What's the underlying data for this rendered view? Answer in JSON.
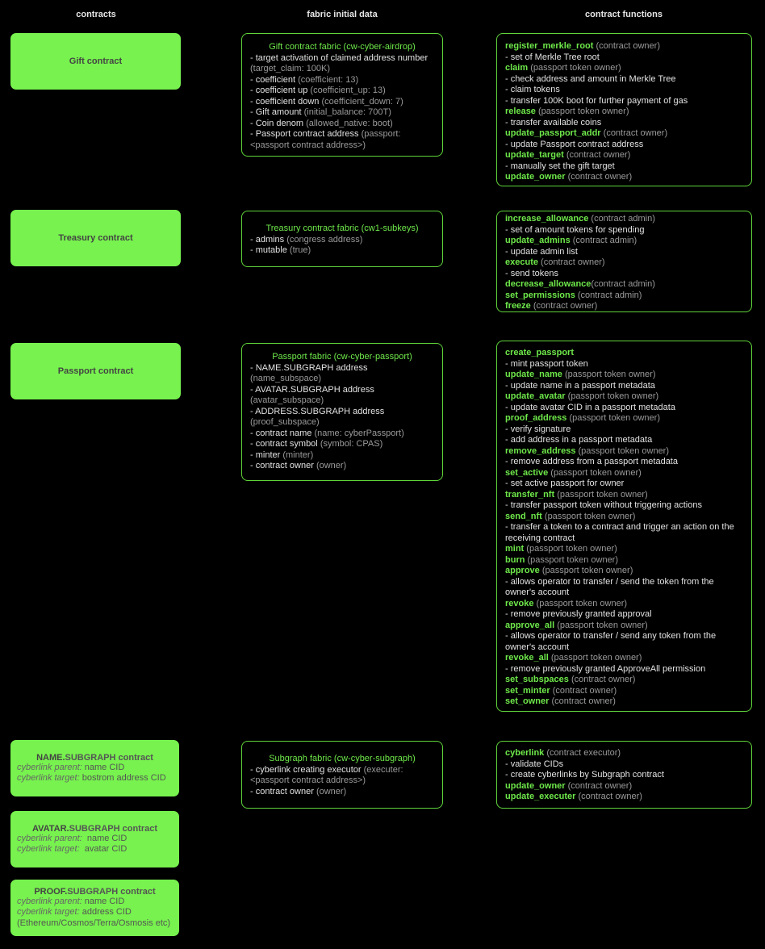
{
  "headers": {
    "contracts": "contracts",
    "fabric": "fabric initial data",
    "functions": "contract functions"
  },
  "rows": {
    "gift": {
      "contract": "Gift contract",
      "fabric_title": "Gift contract fabric (cw-cyber-airdrop)",
      "fabric_lines": [
        {
          "label": "- target activation of claimed address number",
          "value": ""
        },
        {
          "label": "",
          "value": "(target_claim: 100K)"
        },
        {
          "label": "- coefficient",
          "value": "(coefficient: 13)"
        },
        {
          "label": "- coefficient up",
          "value": "(coefficient_up: 13)"
        },
        {
          "label": "- coefficient down",
          "value": "(coefficient_down: 7)"
        },
        {
          "label": "- Gift amount",
          "value": "(initial_balance: 700T)"
        },
        {
          "label": "- Coin denom",
          "value": "(allowed_native: boot)"
        },
        {
          "label": "- Passport contract address",
          "value": "(passport:"
        },
        {
          "label": "",
          "value": "<passport contract address>)"
        }
      ],
      "functions": [
        {
          "name": "register_merkle_root",
          "role": "(contract owner)"
        },
        {
          "desc": "- set of Merkle Tree root"
        },
        {
          "name": "claim",
          "role": "(passport token owner)"
        },
        {
          "desc": "- check address and amount in Merkle Tree"
        },
        {
          "desc": "- claim tokens"
        },
        {
          "desc": "- transfer 100K boot for further payment of gas"
        },
        {
          "name": "release",
          "role": "(passport token owner)"
        },
        {
          "desc": "- transfer available coins"
        },
        {
          "name": "update_passport_addr",
          "role": "(contract owner)"
        },
        {
          "desc": "- update Passport contract address"
        },
        {
          "name": "update_target",
          "role": "(contract owner)"
        },
        {
          "desc": "- manually set the gift target"
        },
        {
          "name": "update_owner",
          "role": "(contract owner)"
        }
      ]
    },
    "treasury": {
      "contract": "Treasury contract",
      "fabric_title": "Treasury contract fabric (cw1-subkeys)",
      "fabric_lines": [
        {
          "label": "- admins ",
          "value": "(congress address)"
        },
        {
          "label": "- mutable",
          "value": "(true)"
        }
      ],
      "functions": [
        {
          "name": "increase_allowance",
          "role": "(contract admin)"
        },
        {
          "desc": "- set of amount tokens for spending"
        },
        {
          "name": "update_admins",
          "role": "(contract admin)"
        },
        {
          "desc": "- update admin list"
        },
        {
          "name": "execute",
          "role": "(contract owner)"
        },
        {
          "desc": "- send tokens"
        },
        {
          "name": "decrease_allowance",
          "role": "(contract admin)",
          "nospace": true
        },
        {
          "name": "set_permissions",
          "role": "(contract admin)"
        },
        {
          "name": "freeze",
          "role": "(contract owner)"
        }
      ]
    },
    "passport": {
      "contract": "Passport contract",
      "fabric_title": "Passport fabric (cw-cyber-passport)",
      "fabric_lines": [
        {
          "label": "- NAME.SUBGRAPH address",
          "value": ""
        },
        {
          "label": "",
          "value": "(name_subspace)"
        },
        {
          "label": "- AVATAR.SUBGRAPH address",
          "value": ""
        },
        {
          "label": "",
          "value": "(avatar_subspace)"
        },
        {
          "label": "- ADDRESS.SUBGRAPH address",
          "value": ""
        },
        {
          "label": "",
          "value": "(proof_subspace)"
        },
        {
          "label": "- contract name",
          "value": "(name: cyberPassport)"
        },
        {
          "label": "- contract symbol",
          "value": "(symbol: CPAS)"
        },
        {
          "label": "- minter",
          "value": "(minter)"
        },
        {
          "label": "- contract owner",
          "value": "(owner)"
        }
      ],
      "functions": [
        {
          "name": "create_passport",
          "role": ""
        },
        {
          "desc": "- mint passport token"
        },
        {
          "name": "update_name",
          "role": "(passport token owner)"
        },
        {
          "desc": "- update name in a passport metadata"
        },
        {
          "name": "update_avatar",
          "role": "(passport token owner)"
        },
        {
          "desc": "- update avatar CID in a passport metadata"
        },
        {
          "name": "proof_address",
          "role": "(passport token owner)"
        },
        {
          "desc": "- verify signature"
        },
        {
          "desc": "- add address in a passport metadata"
        },
        {
          "name": "remove_address",
          "role": "(passport token owner)"
        },
        {
          "desc": "- remove address from a passport metadata"
        },
        {
          "name": "set_active",
          "role": "(passport token owner)"
        },
        {
          "desc": "- set active passport for owner"
        },
        {
          "name": "transfer_nft",
          "role": "(passport token owner)"
        },
        {
          "desc": "- transfer passport token without triggering actions"
        },
        {
          "name": "send_nft",
          "role": "(passport token owner)"
        },
        {
          "desc": "- transfer a token to a contract and trigger an action on the"
        },
        {
          "desc": "receiving contract"
        },
        {
          "name": "mint",
          "role": "(passport token owner)"
        },
        {
          "name": "burn",
          "role": "(passport token owner)"
        },
        {
          "name": "approve",
          "role": "(passport token owner)"
        },
        {
          "desc": "- allows operator to transfer / send the token from the"
        },
        {
          "desc": "owner's account"
        },
        {
          "name": "revoke",
          "role": "(passport token owner)"
        },
        {
          "desc": "- remove previously granted approval"
        },
        {
          "name": "approve_all",
          "role": "(passport token owner)"
        },
        {
          "desc": "- allows operator to transfer / send any token from the"
        },
        {
          "desc": "owner's account"
        },
        {
          "name": "revoke_all",
          "role": "(passport token owner)"
        },
        {
          "desc": "- remove previously granted ApproveAll permission"
        },
        {
          "name": "set_subspaces",
          "role": "(contract owner)"
        },
        {
          "name": "set_minter",
          "role": "(contract owner)"
        },
        {
          "name": "set_owner",
          "role": "(contract owner)"
        }
      ]
    },
    "subgraph": {
      "contracts": [
        {
          "title_prefix": "NAME.",
          "title_rest": "SUBGRAPH contract",
          "lines": [
            {
              "label": "cyberlink parent:",
              "value": " name CID"
            },
            {
              "label": "cyberlink target:",
              "value": " bostrom address CID"
            }
          ]
        },
        {
          "title_prefix": "AVATAR.",
          "title_rest": "SUBGRAPH contract",
          "lines": [
            {
              "label": "cyberlink parent:",
              "value": "  name CID"
            },
            {
              "label": "cyberlink target:",
              "value": "  avatar CID"
            }
          ]
        },
        {
          "title_prefix": "PROOF.",
          "title_rest": "SUBGRAPH contract",
          "lines": [
            {
              "label": "cyberlink parent:",
              "value": " name CID"
            },
            {
              "label": "cyberlink target:",
              "value": " address CID"
            },
            {
              "label": "",
              "value": "(Ethereum/Cosmos/Terra/Osmosis etc)"
            }
          ]
        }
      ],
      "fabric_title": "Subgraph fabric (cw-cyber-subgraph)",
      "fabric_lines": [
        {
          "label": "- cyberlink creating executor",
          "value": "(executer:"
        },
        {
          "label": "",
          "value": "<passport contract address>)"
        },
        {
          "label": "- contract owner",
          "value": "(owner)"
        }
      ],
      "functions": [
        {
          "name": "cyberlink",
          "role": "(contract executor)"
        },
        {
          "desc": "- validate CIDs"
        },
        {
          "desc": "- create cyberlinks by Subgraph contract"
        },
        {
          "name": "update_owner",
          "role": "(contract owner)"
        },
        {
          "name": "update_executer",
          "role": "(contract owner)"
        }
      ]
    }
  },
  "colors": {
    "contract_fill": "#77f24e",
    "accent_green": "#6ee84a",
    "border_green": "#5fd43a",
    "background": "#000000"
  }
}
